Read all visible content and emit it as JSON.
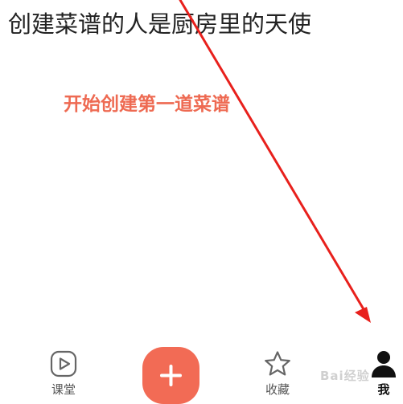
{
  "page": {
    "headline": "创建菜谱的人是厨房里的天使",
    "cta_text": "开始创建第一道菜谱"
  },
  "tabbar": {
    "items": [
      {
        "label": "课堂",
        "icon": "play-video-icon"
      },
      {
        "label": "",
        "icon": "plus-icon"
      },
      {
        "label": "收藏",
        "icon": "star-icon"
      },
      {
        "label": "我",
        "icon": "user-icon"
      }
    ]
  },
  "watermark": "Bai经验",
  "colors": {
    "accent": "#f26b55",
    "cta_text": "#ee6a52",
    "annotation_arrow": "#e8201c"
  }
}
